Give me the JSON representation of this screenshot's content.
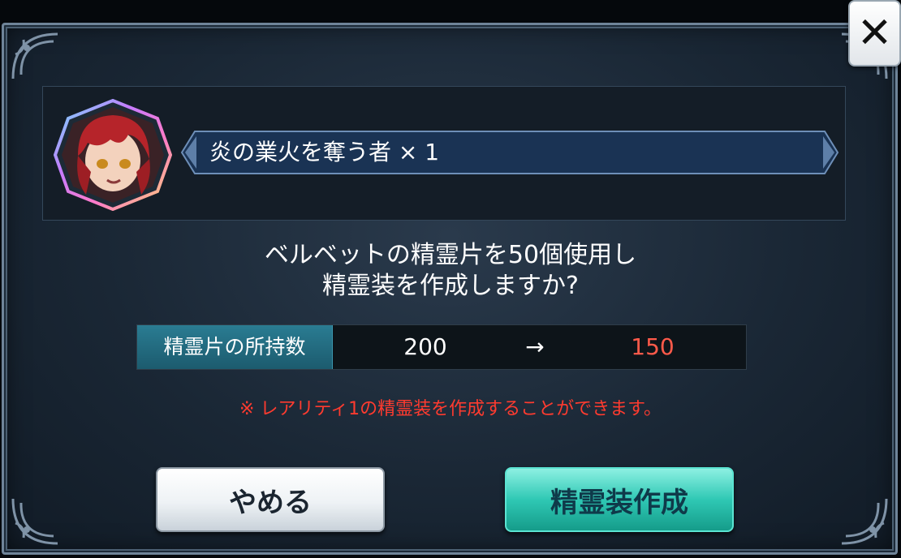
{
  "dialog": {
    "close_label": "✕",
    "item": {
      "name": "炎の業火を奪う者 × 1",
      "portrait_icon": "character-portrait"
    },
    "question_line1": "ベルベットの精霊片を50個使用し",
    "question_line2": "精霊装を作成しますか?",
    "count": {
      "label": "精霊片の所持数",
      "before": "200",
      "arrow": "→",
      "after": "150"
    },
    "notice": "※ レアリティ1の精霊装を作成することができます。",
    "buttons": {
      "cancel": "やめる",
      "create": "精霊装作成"
    }
  },
  "colors": {
    "accent_teal": "#1f6f86",
    "warning_red": "#ff3b2f",
    "create_button": "#2fc8b4"
  }
}
